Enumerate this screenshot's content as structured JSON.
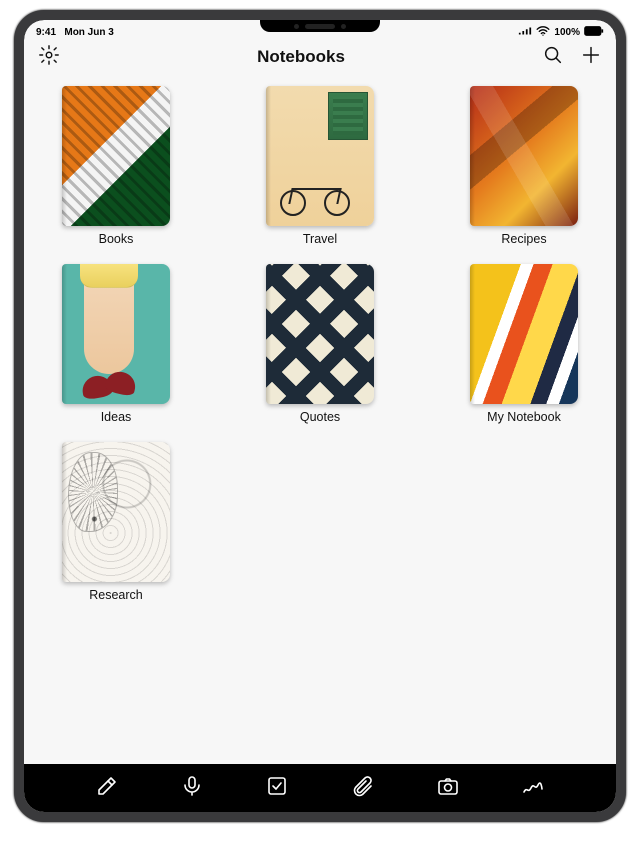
{
  "statusbar": {
    "time": "9:41",
    "date": "Mon Jun 3",
    "battery": "100%"
  },
  "header": {
    "title": "Notebooks"
  },
  "icons": {
    "settings": "gear-icon",
    "search": "search-icon",
    "add": "plus-icon",
    "compose": "compose-icon",
    "mic": "mic-icon",
    "checklist": "checklist-icon",
    "attach": "paperclip-icon",
    "camera": "camera-icon",
    "sketch": "sketch-icon"
  },
  "notebooks": [
    {
      "label": "Books",
      "cover": "cov-books"
    },
    {
      "label": "Travel",
      "cover": "cov-travel"
    },
    {
      "label": "Recipes",
      "cover": "cov-recipes"
    },
    {
      "label": "Ideas",
      "cover": "cov-ideas"
    },
    {
      "label": "Quotes",
      "cover": "cov-quotes"
    },
    {
      "label": "My Notebook",
      "cover": "cov-my"
    },
    {
      "label": "Research",
      "cover": "cov-research"
    }
  ]
}
